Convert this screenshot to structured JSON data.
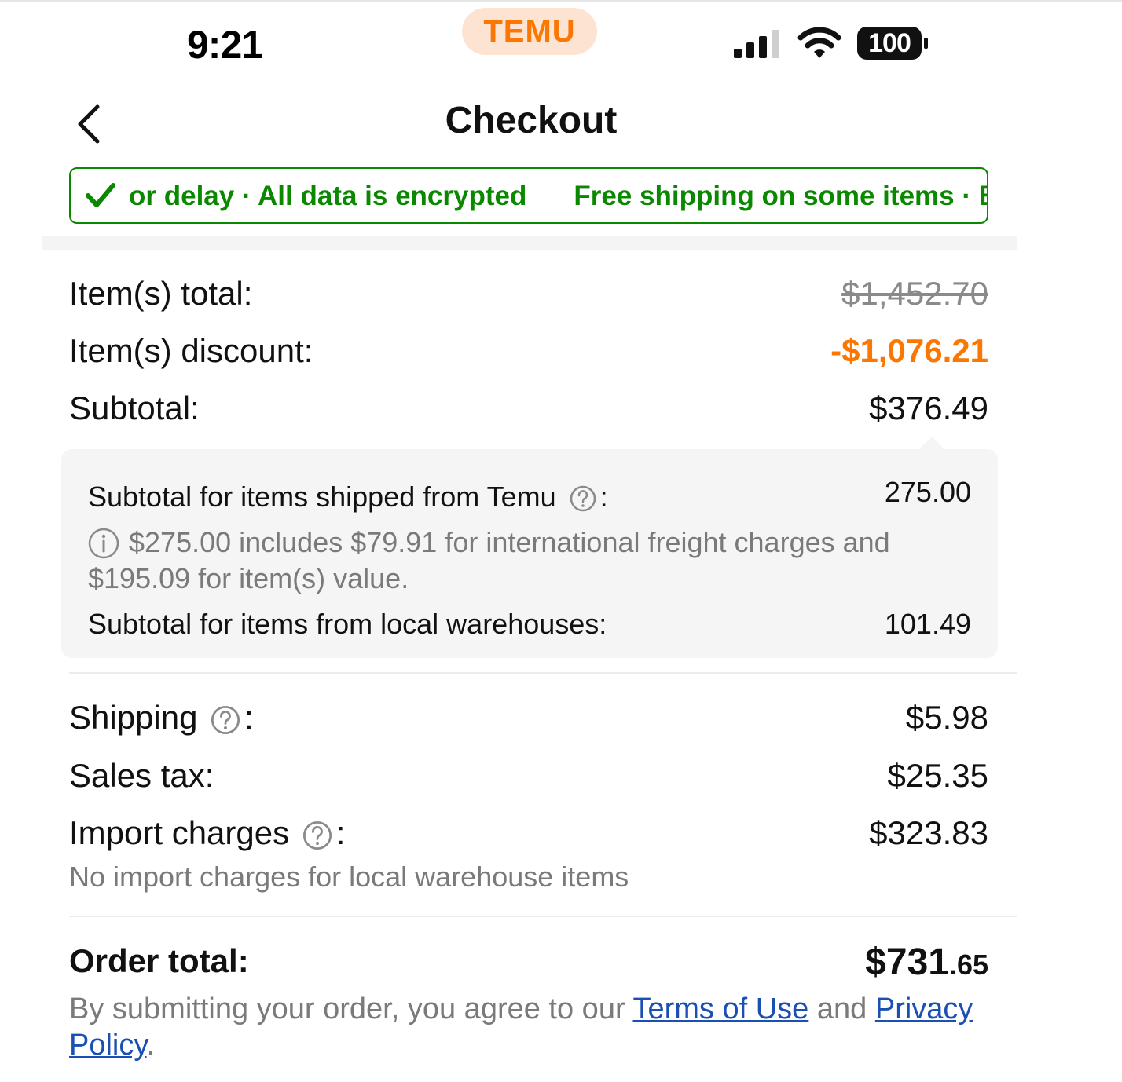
{
  "status_bar": {
    "time": "9:21",
    "app_badge": "TEMU",
    "battery": "100"
  },
  "header": {
    "title": "Checkout"
  },
  "trust_banner": {
    "message_1": "or delay · All data is encrypted",
    "message_2": "Free shipping on some items · Be",
    "color": "#0a8800"
  },
  "summary": {
    "items_total_label": "Item(s) total:",
    "items_total_value": "$1,452.70",
    "items_discount_label": "Item(s) discount:",
    "items_discount_value": "-$1,076.21",
    "subtotal_label": "Subtotal:",
    "subtotal_value": "$376.49"
  },
  "breakdown": {
    "temu_label": "Subtotal for items shipped from Temu",
    "temu_value": "275.00",
    "temu_note": "$275.00 includes $79.91 for international freight charges and $195.09 for item(s) value.",
    "local_label": "Subtotal for items from local warehouses:",
    "local_value": "101.49"
  },
  "fees": {
    "shipping_label": "Shipping",
    "shipping_value": "$5.98",
    "sales_tax_label": "Sales tax:",
    "sales_tax_value": "$25.35",
    "import_label": "Import charges",
    "import_value": "$323.83",
    "import_note": "No import charges for local warehouse items"
  },
  "order_total": {
    "label": "Order total:",
    "value_main": "$731",
    "value_cents": ".65"
  },
  "legal": {
    "prefix": "By submitting your order, you agree to our",
    "terms_link": "Terms of Use",
    "and": "and",
    "privacy_link": "Privacy Policy",
    "suffix": "."
  },
  "colors": {
    "accent_orange": "#fb7701",
    "trust_green": "#0a8800",
    "link_blue": "#1a4fb4"
  }
}
